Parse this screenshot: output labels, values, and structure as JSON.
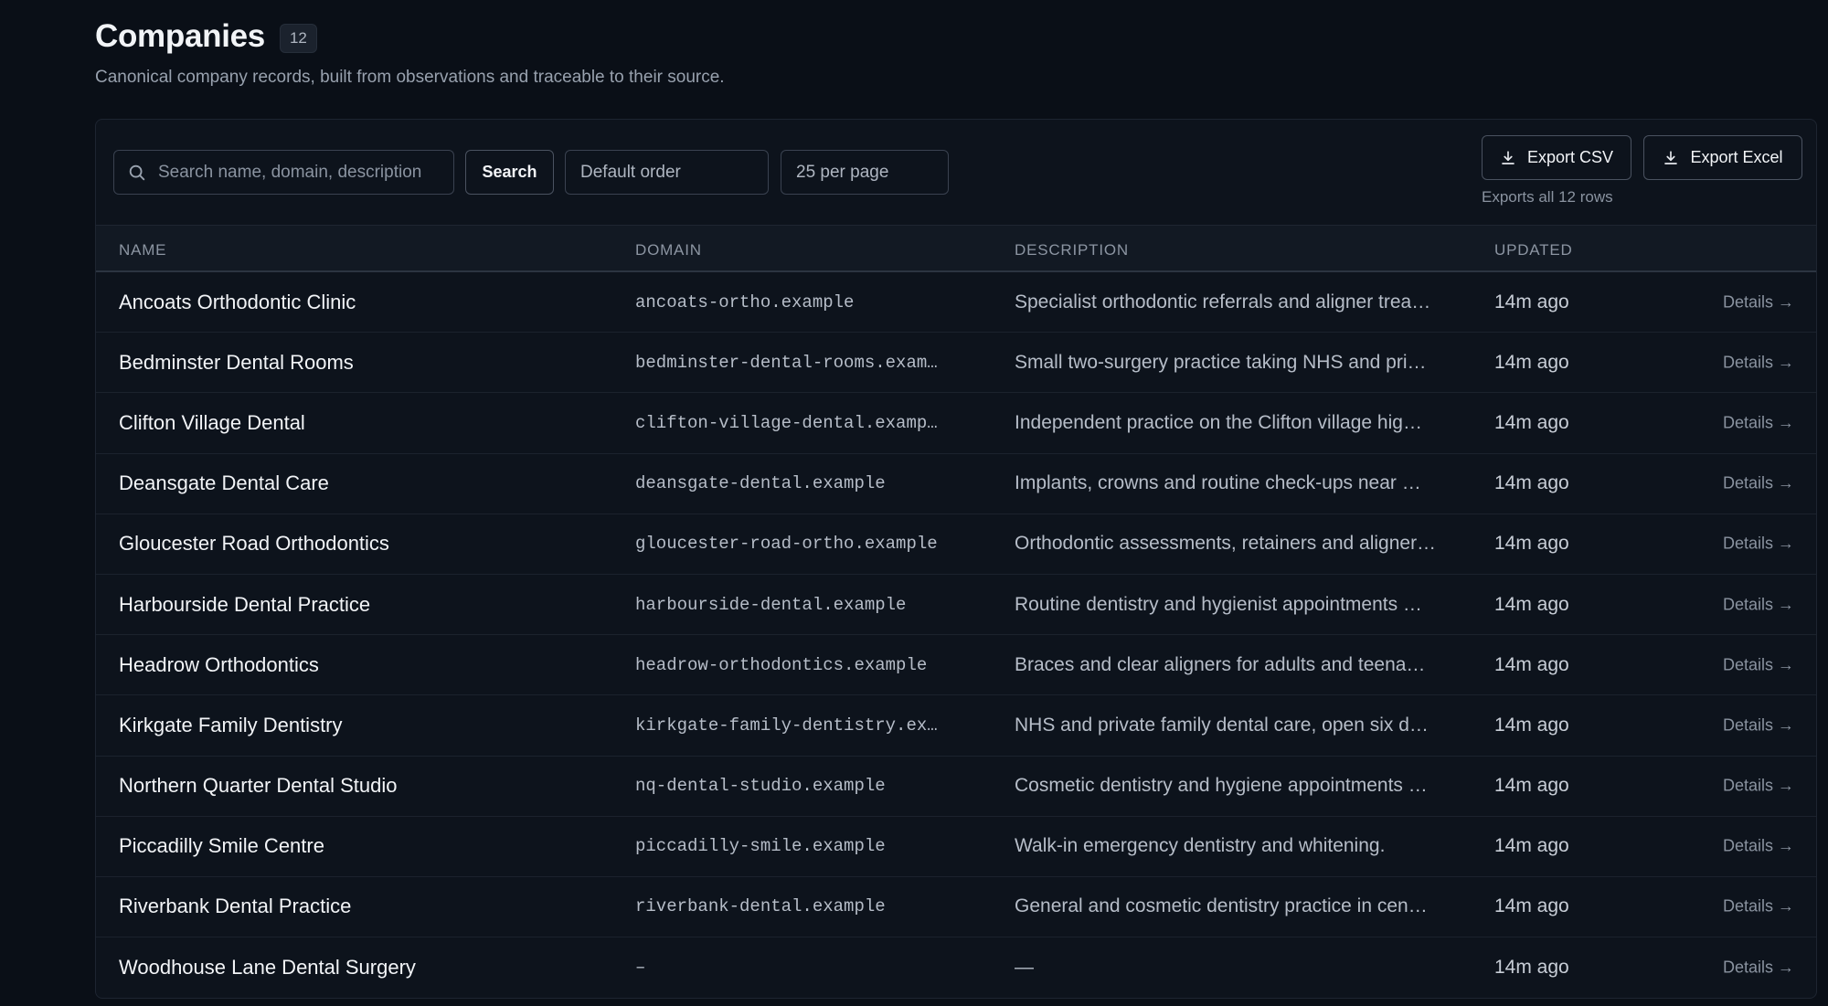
{
  "header": {
    "title": "Companies",
    "count": "12",
    "subtitle": "Canonical company records, built from observations and traceable to their source."
  },
  "toolbar": {
    "search_placeholder": "Search name, domain, description",
    "search_button": "Search",
    "order_value": "Default order",
    "per_page_value": "25 per page",
    "export_csv": "Export CSV",
    "export_excel": "Export Excel",
    "export_note": "Exports all 12 rows"
  },
  "table": {
    "columns": [
      "NAME",
      "DOMAIN",
      "DESCRIPTION",
      "UPDATED"
    ],
    "details_label": "Details →",
    "rows": [
      {
        "name": "Ancoats Orthodontic Clinic",
        "domain": "ancoats-ortho.example",
        "description": "Specialist orthodontic referrals and aligner trea…",
        "updated": "14m ago"
      },
      {
        "name": "Bedminster Dental Rooms",
        "domain": "bedminster-dental-rooms.exam…",
        "description": "Small two-surgery practice taking NHS and pri…",
        "updated": "14m ago"
      },
      {
        "name": "Clifton Village Dental",
        "domain": "clifton-village-dental.examp…",
        "description": "Independent practice on the Clifton village hig…",
        "updated": "14m ago"
      },
      {
        "name": "Deansgate Dental Care",
        "domain": "deansgate-dental.example",
        "description": "Implants, crowns and routine check-ups near …",
        "updated": "14m ago"
      },
      {
        "name": "Gloucester Road Orthodontics",
        "domain": "gloucester-road-ortho.example",
        "description": "Orthodontic assessments, retainers and aligner…",
        "updated": "14m ago"
      },
      {
        "name": "Harbourside Dental Practice",
        "domain": "harbourside-dental.example",
        "description": "Routine dentistry and hygienist appointments …",
        "updated": "14m ago"
      },
      {
        "name": "Headrow Orthodontics",
        "domain": "headrow-orthodontics.example",
        "description": "Braces and clear aligners for adults and teena…",
        "updated": "14m ago"
      },
      {
        "name": "Kirkgate Family Dentistry",
        "domain": "kirkgate-family-dentistry.ex…",
        "description": "NHS and private family dental care, open six d…",
        "updated": "14m ago"
      },
      {
        "name": "Northern Quarter Dental Studio",
        "domain": "nq-dental-studio.example",
        "description": "Cosmetic dentistry and hygiene appointments …",
        "updated": "14m ago"
      },
      {
        "name": "Piccadilly Smile Centre",
        "domain": "piccadilly-smile.example",
        "description": "Walk-in emergency dentistry and whitening.",
        "updated": "14m ago"
      },
      {
        "name": "Riverbank Dental Practice",
        "domain": "riverbank-dental.example",
        "description": "General and cosmetic dentistry practice in cen…",
        "updated": "14m ago"
      },
      {
        "name": "Woodhouse Lane Dental Surgery",
        "domain": "–",
        "description": "—",
        "updated": "14m ago"
      }
    ]
  },
  "icons": {
    "search": "search-icon",
    "download": "download-icon"
  }
}
